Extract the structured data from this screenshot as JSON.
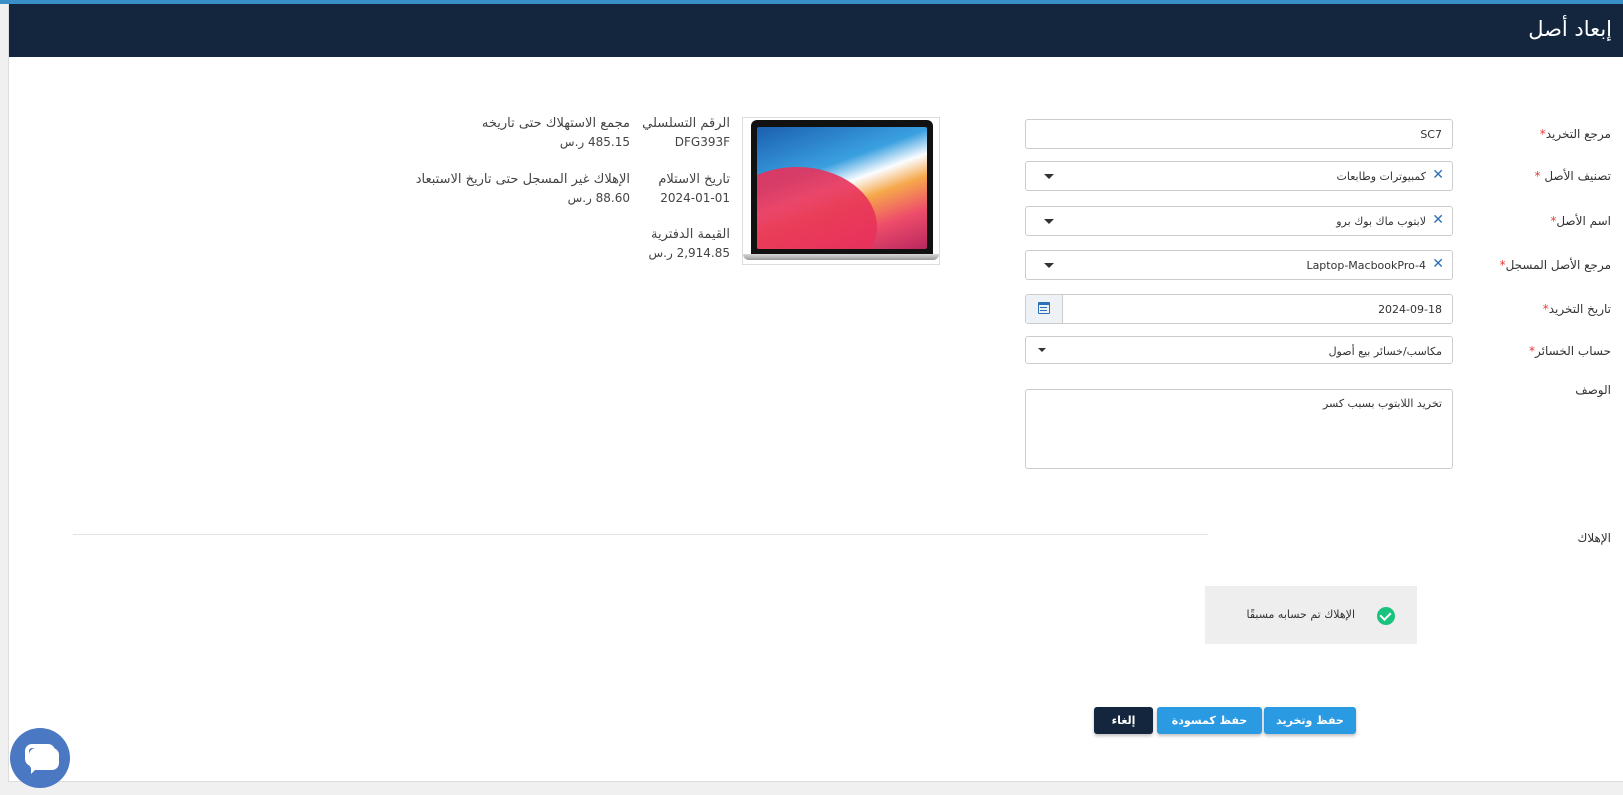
{
  "header": {
    "title": "إبعاد أصل"
  },
  "form": {
    "ref_label": "مرجع التخريد",
    "ref_value": "SC7",
    "category_label": "تصنيف الأصل",
    "category_value": "كمبيوترات وطابعات",
    "asset_name_label": "اسم الأصل",
    "asset_name_value": "لابتوب ماك بوك برو",
    "registered_ref_label": "مرجع الأصل المسجل",
    "registered_ref_value": "Laptop-MacbookPro-4",
    "date_label": "تاريخ التخريد",
    "date_value": "2024-09-18",
    "loss_account_label": "حساب الخسائر",
    "loss_account_value": "مكاسب/خسائر بيع أصول",
    "description_label": "الوصف",
    "description_value": "تخريد اللابتوب بسبب كسر",
    "required_mark": "*"
  },
  "asset_info": {
    "serial_label": "الرقم التسلسلي",
    "serial_value": "DFG393F",
    "received_label": "تاريخ الاستلام",
    "received_value": "2024-01-01",
    "book_value_label": "القيمة الدفترية",
    "book_value": "2,914.85 ر.س",
    "accumulated_label": "مجمع الاستهلاك حتى تاريخه",
    "accumulated_value": "485.15 ر.س",
    "unrecorded_label": "الإهلاك غير المسجل حتى تاريخ الاستبعاد",
    "unrecorded_value": "88.60 ر.س"
  },
  "depreciation": {
    "section_label": "الإهلاك",
    "notice": "الإهلاك تم حسابه مسبقًا"
  },
  "actions": {
    "save_scrap": "حفظ وتخريد",
    "save_draft": "حفظ كمسودة",
    "cancel": "إلغاء"
  },
  "colors": {
    "header_bg": "#14263d",
    "primary": "#2a9ae3",
    "success": "#19c37d",
    "required": "#e53935"
  }
}
